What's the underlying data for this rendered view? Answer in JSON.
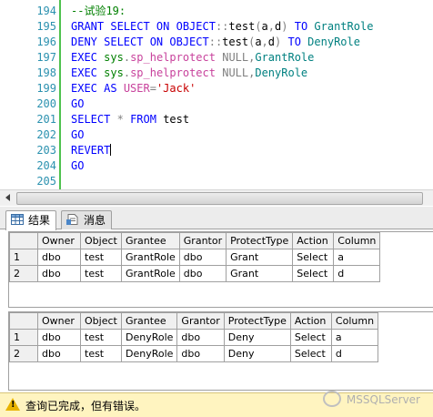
{
  "editor": {
    "lines": [
      {
        "n": "194",
        "text": "--试验19:"
      },
      {
        "n": "195",
        "text": "GRANT SELECT ON OBJECT::test(a,d) TO GrantRole"
      },
      {
        "n": "196",
        "text": "DENY SELECT ON OBJECT::test(a,d) TO DenyRole"
      },
      {
        "n": "197",
        "text": "EXEC sys.sp_helprotect NULL,GrantRole"
      },
      {
        "n": "198",
        "text": "EXEC sys.sp_helprotect NULL,DenyRole"
      },
      {
        "n": "199",
        "text": "EXEC AS USER='Jack'"
      },
      {
        "n": "200",
        "text": "GO"
      },
      {
        "n": "201",
        "text": "SELECT * FROM test"
      },
      {
        "n": "202",
        "text": "GO"
      },
      {
        "n": "203",
        "text": "REVERT"
      },
      {
        "n": "204",
        "text": "GO"
      },
      {
        "n": "205",
        "text": ""
      }
    ]
  },
  "tabs": [
    {
      "label": "结果",
      "icon": "grid-icon",
      "active": true
    },
    {
      "label": "消息",
      "icon": "message-icon",
      "active": false
    }
  ],
  "grids": [
    {
      "columns": [
        "Owner",
        "Object",
        "Grantee",
        "Grantor",
        "ProtectType",
        "Action",
        "Column"
      ],
      "rows": [
        {
          "num": "1",
          "cells": [
            "dbo",
            "test",
            "GrantRole",
            "dbo",
            "Grant",
            "Select",
            "a"
          ]
        },
        {
          "num": "2",
          "cells": [
            "dbo",
            "test",
            "GrantRole",
            "dbo",
            "Grant",
            "Select",
            "d"
          ]
        }
      ]
    },
    {
      "columns": [
        "Owner",
        "Object",
        "Grantee",
        "Grantor",
        "ProtectType",
        "Action",
        "Column"
      ],
      "rows": [
        {
          "num": "1",
          "cells": [
            "dbo",
            "test",
            "DenyRole",
            "dbo",
            "Deny",
            "Select",
            "a"
          ]
        },
        {
          "num": "2",
          "cells": [
            "dbo",
            "test",
            "DenyRole",
            "dbo",
            "Deny",
            "Select",
            "d"
          ]
        }
      ]
    }
  ],
  "status": {
    "message": "查询已完成，但有错误。",
    "icon": "warning-icon"
  },
  "watermark": "MSSQLServer",
  "colors": {
    "status_bg": "#fff4c0",
    "keyword": "#0000ff",
    "line_number": "#2b91af"
  }
}
